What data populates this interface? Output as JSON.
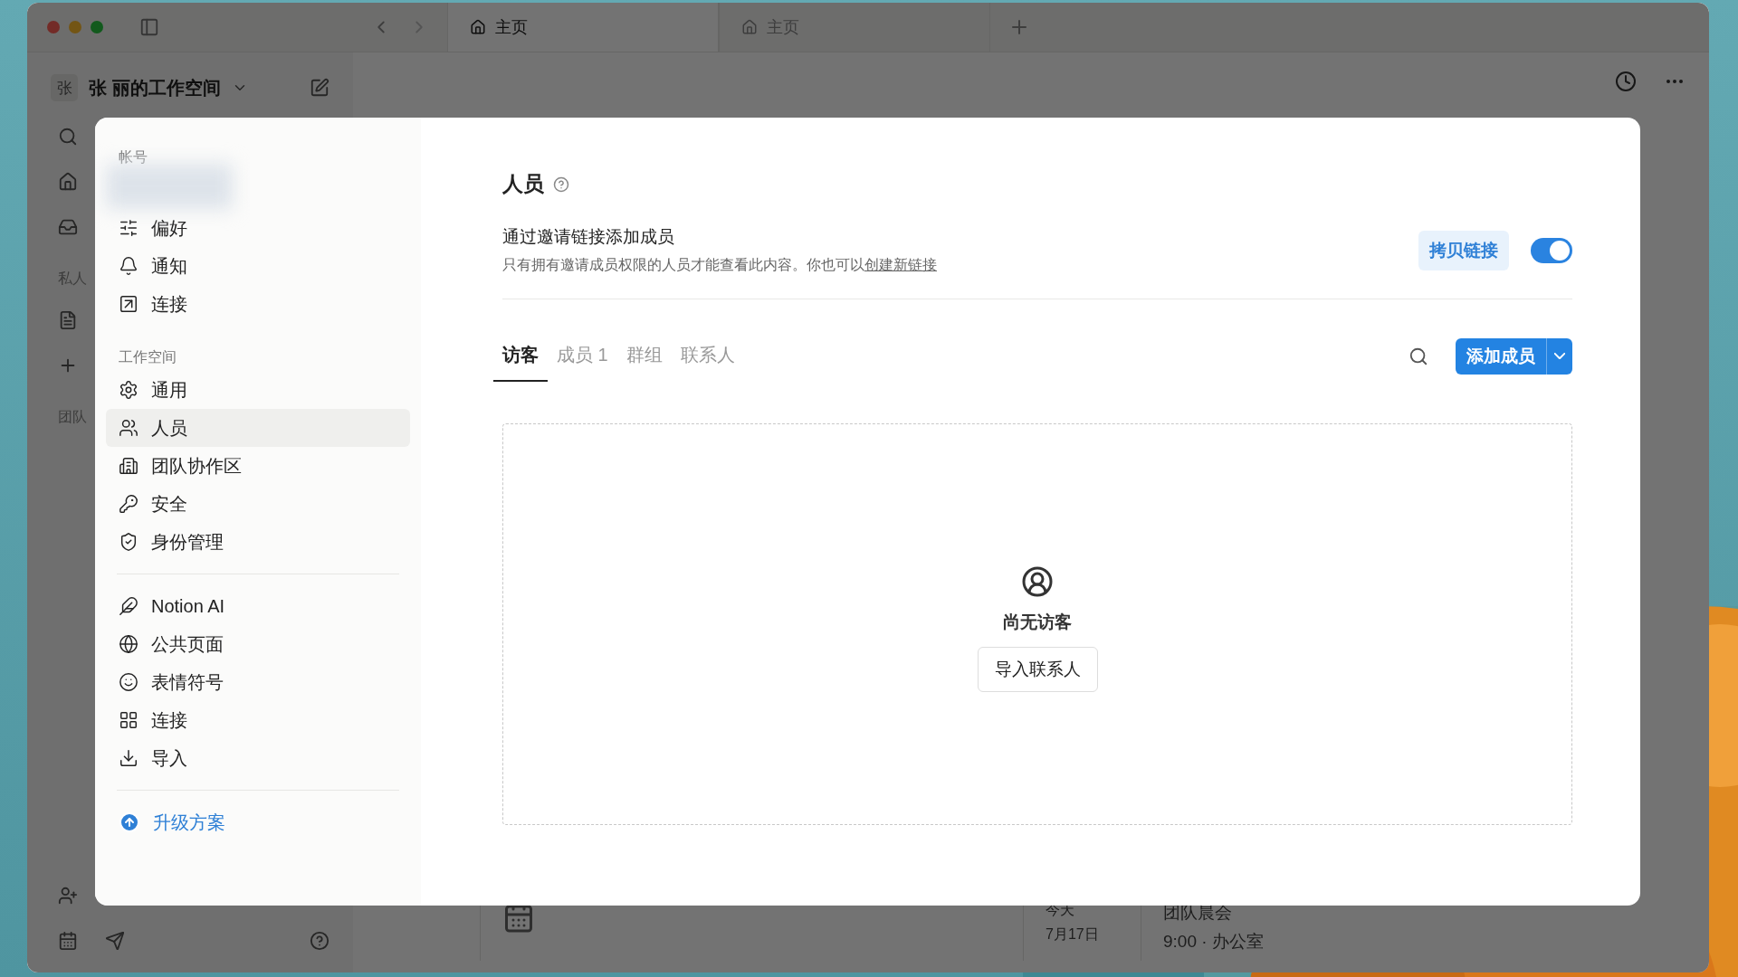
{
  "app": {
    "tabs": [
      {
        "label": "主页",
        "selected": true
      },
      {
        "label": "主页",
        "selected": false
      }
    ],
    "workspace": {
      "badge": "张",
      "name": "张 丽的工作空间"
    },
    "sidebar_sections": [
      "私人",
      "团队"
    ],
    "event": {
      "day": "今天",
      "date": "7月17日",
      "title": "团队晨会",
      "detail": "9:00 · 办公室"
    }
  },
  "settings": {
    "nav_groups": [
      {
        "heading": "帐号",
        "items": [
          {
            "label": "偏好",
            "selected": false
          },
          {
            "label": "通知",
            "selected": false
          },
          {
            "label": "连接",
            "selected": false
          }
        ]
      },
      {
        "heading": "工作空间",
        "items": [
          {
            "label": "通用",
            "selected": false
          },
          {
            "label": "人员",
            "selected": true
          },
          {
            "label": "团队协作区",
            "selected": false
          },
          {
            "label": "安全",
            "selected": false
          },
          {
            "label": "身份管理",
            "selected": false
          }
        ]
      },
      {
        "items": [
          {
            "label": "Notion AI",
            "selected": false
          },
          {
            "label": "公共页面",
            "selected": false
          },
          {
            "label": "表情符号",
            "selected": false
          },
          {
            "label": "连接",
            "selected": false
          },
          {
            "label": "导入",
            "selected": false
          }
        ]
      }
    ],
    "upgrade": "升级方案",
    "title": "人员",
    "invite": {
      "title": "通过邀请链接添加成员",
      "description": "只有拥有邀请成员权限的人员才能查看此内容。你也可以",
      "link": "创建新链接",
      "copy_button": "拷贝链接",
      "enabled": true
    },
    "tabs": [
      {
        "label": "访客",
        "selected": true
      },
      {
        "label": "成员 1",
        "selected": false
      },
      {
        "label": "群组",
        "selected": false
      },
      {
        "label": "联系人",
        "selected": false
      }
    ],
    "add_button": "添加成员",
    "empty": {
      "message": "尚无访客",
      "button": "导入联系人"
    }
  }
}
